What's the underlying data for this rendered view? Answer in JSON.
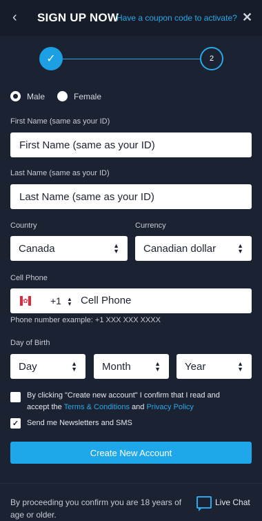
{
  "header": {
    "title": "SIGN UP NOW",
    "coupon_link": "Have a coupon code to activate?",
    "back_icon": "chevron-left-icon",
    "close_icon": "close-icon"
  },
  "stepper": {
    "step1_icon": "check-icon",
    "step2_label": "2"
  },
  "gender": {
    "male_label": "Male",
    "female_label": "Female",
    "selected": "Male"
  },
  "first_name": {
    "label": "First Name (same as your ID)",
    "placeholder": "First Name  (same as your ID)"
  },
  "last_name": {
    "label": "Last Name (same as your ID)",
    "placeholder": "Last Name (same as your ID)"
  },
  "country": {
    "label": "Country",
    "value": "Canada"
  },
  "currency": {
    "label": "Currency",
    "value": "Canadian dollar"
  },
  "phone": {
    "label": "Cell Phone",
    "code": "+1",
    "placeholder": "Cell Phone",
    "hint": "Phone number example: +1 XXX XXX XXXX",
    "flag": "canada-flag-icon"
  },
  "dob": {
    "label": "Day of Birth",
    "day": "Day",
    "month": "Month",
    "year": "Year"
  },
  "terms": {
    "text_before": "By clicking \"Create new account\" I confirm that I read and accept the ",
    "terms_link": "Terms & Conditions",
    "and": " and ",
    "privacy_link": "Privacy Policy",
    "checked": false
  },
  "newsletter": {
    "label": "Send me Newsletters and SMS",
    "checked": true
  },
  "create_button": "Create New Account",
  "footer": {
    "age_notice": "By proceeding you confirm you are 18 years of age or older.",
    "live_chat": "Live Chat"
  },
  "colors": {
    "background": "#1b2231",
    "accent": "#1ea8eb"
  }
}
